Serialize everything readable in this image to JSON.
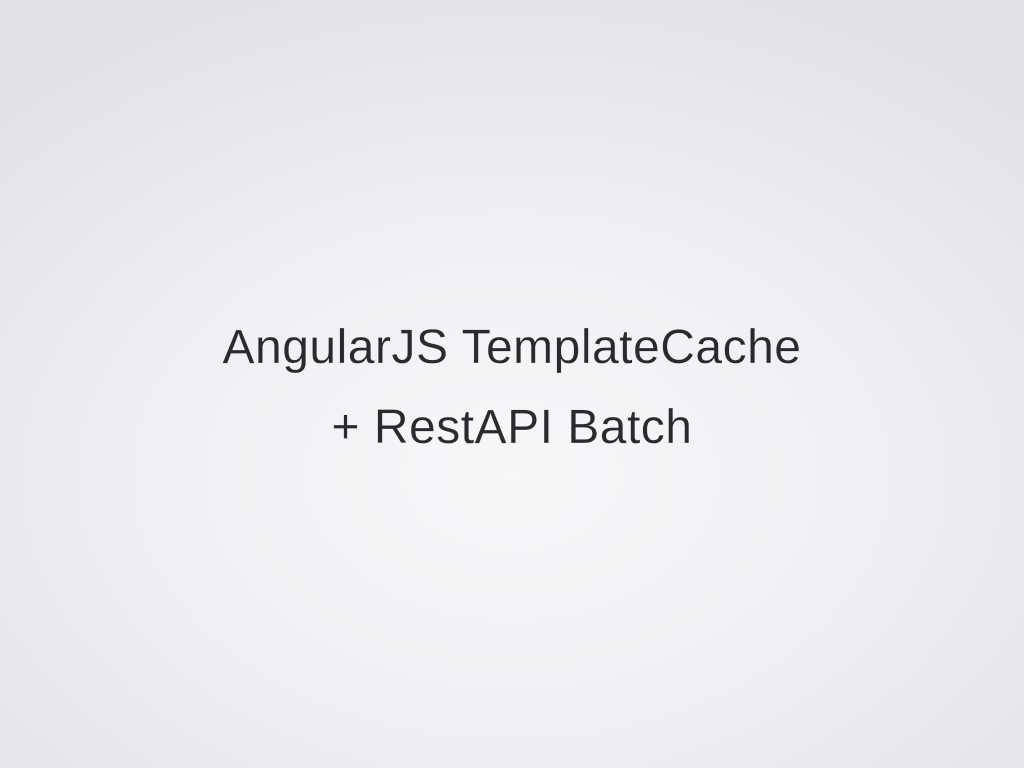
{
  "slide": {
    "title_line_1": "AngularJS TemplateCache",
    "title_line_2": "+ RestAPI Batch"
  }
}
